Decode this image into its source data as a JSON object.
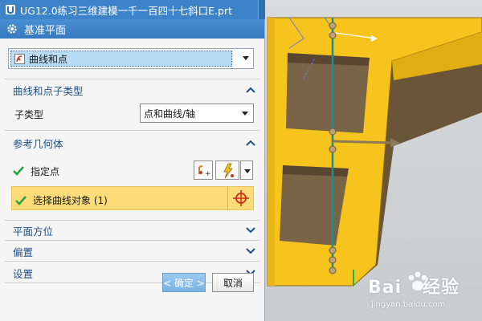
{
  "window": {
    "file_tab_title": "UG12.0练习三维建模一千一百四十七斜口E.prt"
  },
  "dialog": {
    "title": "基准平面",
    "type_selected": "曲线和点",
    "subtype_group_title": "曲线和点子类型",
    "subtype_label": "子类型",
    "subtype_value": "点和曲线/轴",
    "reference_group_title": "参考几何体",
    "specify_point_label": "指定点",
    "select_curve_label": "选择曲线对象 (1)",
    "plane_orientation_title": "平面方位",
    "offset_title": "偏置",
    "settings_title": "设置",
    "ok_label": "< 确定 >",
    "cancel_label": "取消"
  },
  "watermark": {
    "main": "Bai",
    "main_suffix": "经验",
    "sub": "jingyan.baidu.com"
  },
  "colors": {
    "title_bar": "#3d83c9",
    "part_face": "#f6c21c",
    "part_dark": "#5a4630",
    "highlight_row": "#fbdc79",
    "axis_line": "#1d8f8a"
  },
  "icons": {
    "app": "ug-icon",
    "settings": "gear-icon",
    "reset": "reset-icon",
    "close": "close-icon",
    "point": "point-constructor-icon",
    "inferred_point": "inferred-point-icon",
    "target": "crosshair-icon",
    "check": "check-icon"
  }
}
